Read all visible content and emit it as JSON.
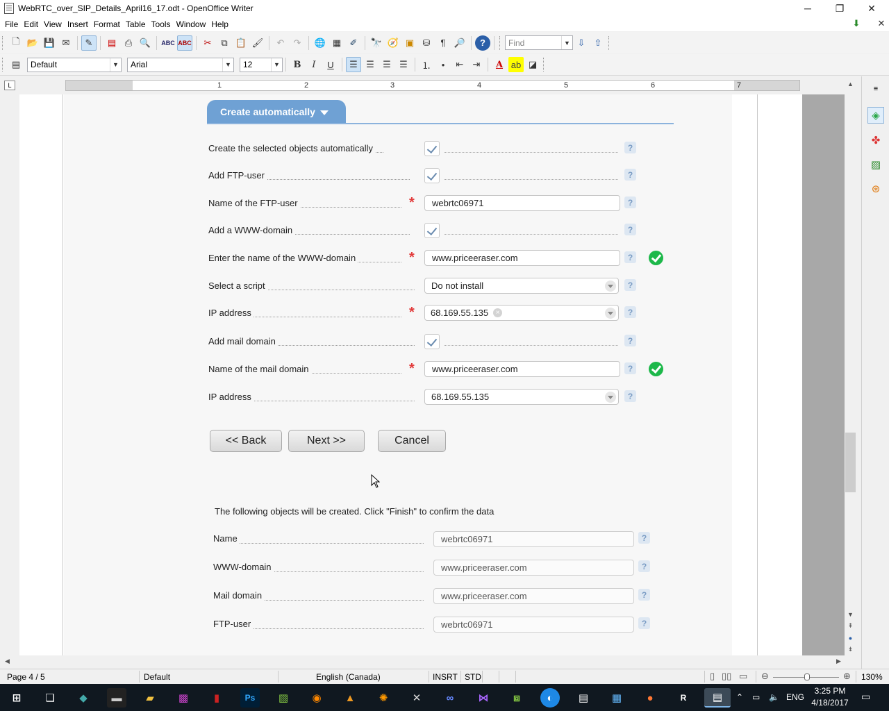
{
  "window": {
    "title": "WebRTC_over_SIP_Details_April16_17.odt - OpenOffice Writer",
    "minimize": "─",
    "restore": "❐",
    "close": "✕"
  },
  "menu": [
    {
      "label": "File"
    },
    {
      "label": "Edit"
    },
    {
      "label": "View"
    },
    {
      "label": "Insert"
    },
    {
      "label": "Format"
    },
    {
      "label": "Table"
    },
    {
      "label": "Tools"
    },
    {
      "label": "Window"
    },
    {
      "label": "Help"
    }
  ],
  "toolbar": {
    "find_placeholder": "Find",
    "paragraph_style": "Default",
    "font_name": "Arial",
    "font_size": "12"
  },
  "screenshot": {
    "tab_label": "Create automatically",
    "rows": [
      {
        "label": "Create the selected objects automatically",
        "kind": "checkbox",
        "required": false,
        "valid": false
      },
      {
        "label": "Add FTP-user",
        "kind": "checkbox",
        "required": false,
        "valid": false
      },
      {
        "label": "Name of the FTP-user",
        "kind": "input",
        "value": "webrtc06971",
        "required": true,
        "valid": false
      },
      {
        "label": "Add a WWW-domain",
        "kind": "checkbox",
        "required": false,
        "valid": false
      },
      {
        "label": "Enter the name of the WWW-domain",
        "kind": "input",
        "value": "www.priceeraser.com",
        "required": true,
        "valid": true
      },
      {
        "label": "Select a script",
        "kind": "select",
        "value": "Do not install",
        "required": false,
        "valid": false
      },
      {
        "label": "IP address",
        "kind": "tagselect",
        "value": "68.169.55.135",
        "required": true,
        "valid": false
      },
      {
        "label": "Add mail domain",
        "kind": "checkbox",
        "required": false,
        "valid": false
      },
      {
        "label": "Name of the mail domain",
        "kind": "input",
        "value": "www.priceeraser.com",
        "required": true,
        "valid": true
      },
      {
        "label": "IP address",
        "kind": "select",
        "value": "68.169.55.135",
        "required": false,
        "valid": false
      }
    ],
    "buttons": {
      "back": "<< Back",
      "next": "Next >>",
      "cancel": "Cancel"
    },
    "confirm_text": "The following objects will be created. Click \"Finish\" to confirm the data",
    "summary": [
      {
        "label": "Name",
        "value": "webrtc06971"
      },
      {
        "label": "WWW-domain",
        "value": "www.priceeraser.com"
      },
      {
        "label": "Mail domain",
        "value": "www.priceeraser.com"
      },
      {
        "label": "FTP-user",
        "value": "webrtc06971"
      }
    ],
    "help_glyph": "?",
    "required_glyph": "*"
  },
  "ruler": {
    "numbers": [
      "1",
      "2",
      "3",
      "4",
      "5",
      "6",
      "7"
    ]
  },
  "status": {
    "page": "Page 4 / 5",
    "style": "Default",
    "language": "English (Canada)",
    "insert_mode": "INSRT",
    "selection_mode": "STD",
    "zoom": "130%"
  },
  "taskbar": {
    "lang": "ENG",
    "time": "3:25 PM",
    "date": "4/18/2017"
  }
}
